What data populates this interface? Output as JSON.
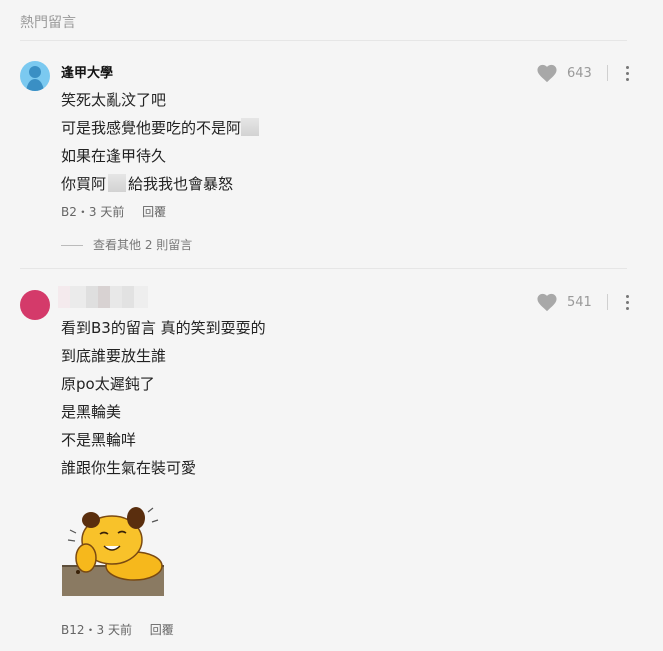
{
  "section_title": "熱門留言",
  "comments": [
    {
      "author": "逢甲大學",
      "likes": "643",
      "lines": [
        "笑死太亂汶了吧",
        "可是我感覺他要吃的不是阿",
        "如果在逢甲待久",
        "你買阿",
        "給我我也會暴怒"
      ],
      "meta": "B2・3 天前",
      "reply_label": "回覆",
      "more_replies": "查看其他 2 則留言"
    },
    {
      "author": "",
      "likes": "541",
      "lines": [
        "看到B3的留言 真的笑到耍耍的",
        "到底誰要放生誰",
        "原po太遲鈍了",
        "是黑輪美",
        "不是黑輪咩",
        "誰跟你生氣在裝可愛"
      ],
      "meta": "B12・3 天前",
      "reply_label": "回覆"
    }
  ],
  "colors": {
    "avatar1": "#7bc9f0",
    "avatar2": "#d43a6a",
    "text": "#222222",
    "muted": "#9a9a9a"
  },
  "icons": {
    "like": "heart-icon",
    "more": "more-vertical-icon",
    "sticker": "yellow-dog-sticker"
  }
}
